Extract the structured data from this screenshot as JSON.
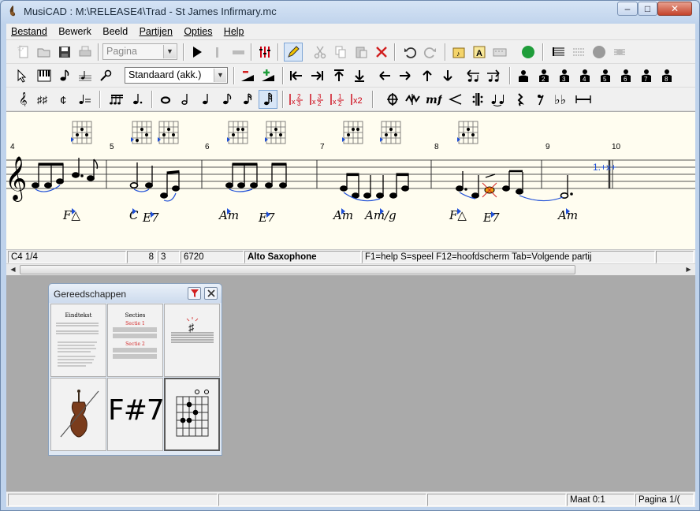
{
  "window": {
    "title": "MusiCAD : M:\\RELEASE4\\Trad - St James Infirmary.mc",
    "min": "–",
    "max": "□",
    "close": "✕"
  },
  "menu": [
    {
      "u": "B",
      "rest": "estand"
    },
    {
      "u": "",
      "pre": "Be",
      "uu": "w",
      "post": "erk"
    },
    {
      "pre": "Bee",
      "uu": "l",
      "post": "d"
    },
    {
      "u": "P",
      "rest": "artijen"
    },
    {
      "u": "O",
      "rest": "pties"
    },
    {
      "u": "H",
      "rest": "elp"
    }
  ],
  "menu_labels": [
    "Bestand",
    "Bewerk",
    "Beeld",
    "Partijen",
    "Opties",
    "Help"
  ],
  "toolbar1": {
    "view_combo": "Pagina"
  },
  "toolbar2": {
    "style_combo": "Standaard (akk.)"
  },
  "score": {
    "measures": [
      "4",
      "5",
      "6",
      "7",
      "8",
      "9",
      "10"
    ],
    "chords": [
      "F△",
      "C",
      "E7",
      "Am",
      "E7",
      "Am",
      "Am/g",
      "F△",
      "E7",
      "Am"
    ],
    "ending_mark": "1.+x+"
  },
  "status": {
    "position": "C4  1/4",
    "num1": "8",
    "num2": "3",
    "num3": "6720",
    "instrument": "Alto Saxophone",
    "help": "F1=help S=speel F12=hoofdscherm Tab=Volgende partij"
  },
  "tools_panel": {
    "title": "Gereedschappen",
    "tile1_title": "Eindtekst",
    "tile2_title": "Secties",
    "tile2_sec1": "Sectie 1",
    "tile2_sec2": "Sectie 2",
    "chord_symbol": "F#7"
  },
  "bottom_status": {
    "measure": "Maat 0:1",
    "page": "Pagina 1/("
  },
  "colors": {
    "accent_blue": "#1f4fd6",
    "score_bg": "#fffdf0",
    "workspace": "#aaaaaa",
    "record_green": "#1f9d3a",
    "delete_red": "#d11f1f"
  }
}
